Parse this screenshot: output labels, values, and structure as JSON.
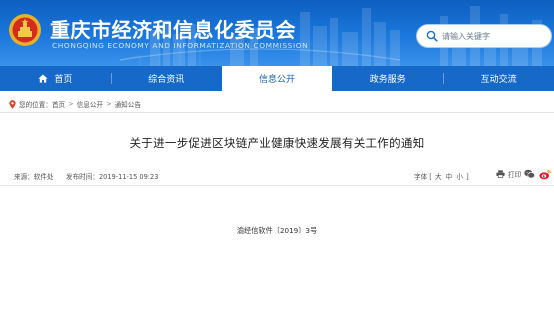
{
  "header": {
    "site_title": "重庆市经济和信息化委员会",
    "site_subtitle": "CHONGQING ECONOMY AND INFORMATIZATION COMMISSION",
    "logo": "emblem-logo",
    "colors": {
      "banner": "#1669c9",
      "accent_active_text": "#1a5fb4"
    }
  },
  "search": {
    "placeholder": "请输入关键字",
    "value": "",
    "icon": "search-icon"
  },
  "nav": {
    "items": [
      {
        "label": "首页",
        "icon": "home-icon",
        "active": false
      },
      {
        "label": "综合资讯",
        "active": false
      },
      {
        "label": "信息公开",
        "active": true
      },
      {
        "label": "政务服务",
        "active": false
      },
      {
        "label": "互动交流",
        "active": false
      }
    ]
  },
  "breadcrumb": {
    "prefix": "您的位置：",
    "items": [
      "首页",
      "信息公开",
      "通知公告"
    ],
    "separator": ">"
  },
  "article": {
    "title": "关于进一步促进区块链产业健康快速发展有关工作的通知",
    "source": "来源：软件处",
    "published": "发布时间：2019-11-15 09:23",
    "font_size_label": "字体",
    "font_sizes": [
      "大",
      "中",
      "小"
    ],
    "print_label": "打印",
    "doc_number": "渝经信软件〔2019〕3号"
  }
}
